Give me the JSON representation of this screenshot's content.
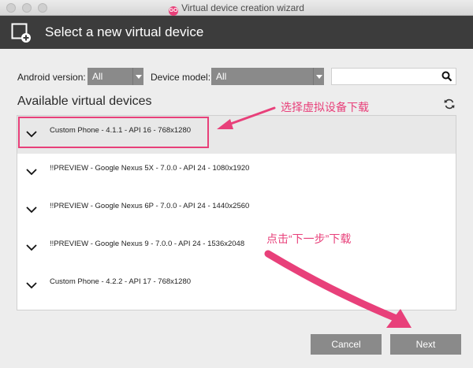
{
  "window": {
    "title": "Virtual device creation wizard",
    "app_icon_text": "GO"
  },
  "header": {
    "title": "Select a new virtual device",
    "icon": "add-device-icon"
  },
  "filters": {
    "android_version_label": "Android version:",
    "android_version_value": "All",
    "device_model_label": "Device model:",
    "device_model_value": "All",
    "search_value": ""
  },
  "section": {
    "title": "Available virtual devices"
  },
  "devices": [
    {
      "label": "Custom Phone - 4.1.1 - API 16 - 768x1280",
      "selected": true
    },
    {
      "label": "!!PREVIEW - Google Nexus 5X - 7.0.0 - API 24 - 1080x1920",
      "selected": false
    },
    {
      "label": "!!PREVIEW - Google Nexus 6P - 7.0.0 - API 24 - 1440x2560",
      "selected": false
    },
    {
      "label": "!!PREVIEW - Google Nexus 9 - 7.0.0 - API 24 - 1536x2048",
      "selected": false
    },
    {
      "label": "Custom Phone - 4.2.2 - API 17 - 768x1280",
      "selected": false
    }
  ],
  "annotations": {
    "select_device": "选择虚拟设备下载",
    "click_next": "点击“下一步”下载"
  },
  "buttons": {
    "cancel": "Cancel",
    "next": "Next"
  },
  "colors": {
    "accent": "#e8407a",
    "header_bg": "#3c3c3c",
    "button_bg": "#8a8a8a"
  }
}
